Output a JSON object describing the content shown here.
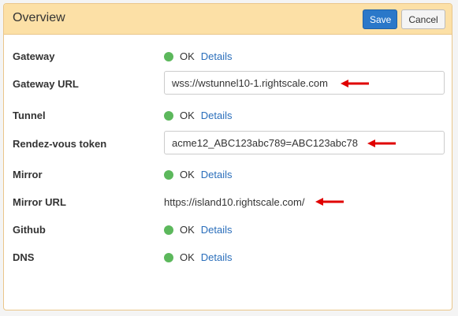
{
  "header": {
    "title": "Overview",
    "save_label": "Save",
    "cancel_label": "Cancel"
  },
  "rows": {
    "gateway": {
      "label": "Gateway",
      "status": "OK",
      "link": "Details"
    },
    "gateway_url": {
      "label": "Gateway URL",
      "value": "wss://wstunnel10-1.rightscale.com"
    },
    "tunnel": {
      "label": "Tunnel",
      "status": "OK",
      "link": "Details"
    },
    "rendezvous_token": {
      "label": "Rendez-vous token",
      "value": "acme12_ABC123abc789=ABC123abc78"
    },
    "mirror": {
      "label": "Mirror",
      "status": "OK",
      "link": "Details"
    },
    "mirror_url": {
      "label": "Mirror URL",
      "value": "https://island10.rightscale.com/"
    },
    "github": {
      "label": "Github",
      "status": "OK",
      "link": "Details"
    },
    "dns": {
      "label": "DNS",
      "status": "OK",
      "link": "Details"
    }
  },
  "colors": {
    "header_bg": "#fce0a6",
    "status_ok": "#5cb85c",
    "link": "#2a6ebb",
    "save_button": "#2a78c9",
    "annotation_arrow": "#e00000"
  },
  "icons": {
    "status": "status-ok-dot-icon",
    "annotation": "red-arrow-icon"
  }
}
